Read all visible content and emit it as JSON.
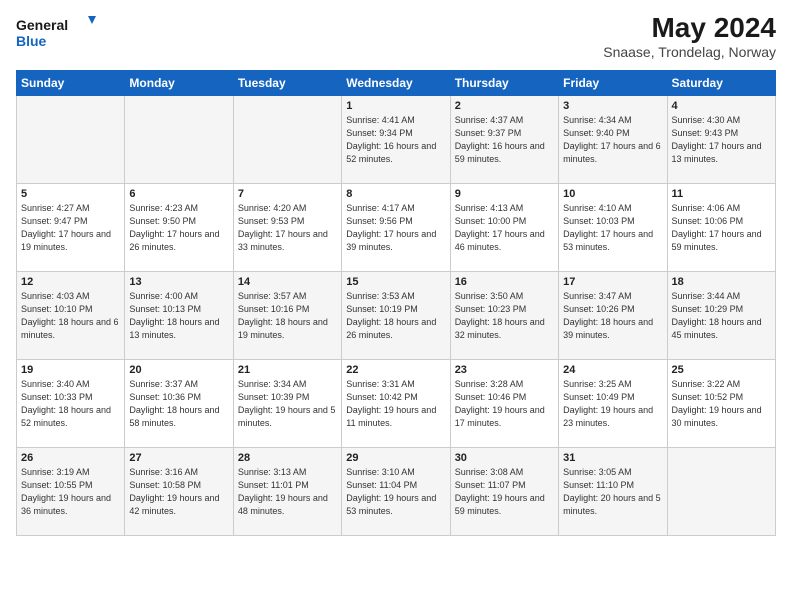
{
  "logo": {
    "line1": "General",
    "line2": "Blue"
  },
  "title": "May 2024",
  "subtitle": "Snaase, Trondelag, Norway",
  "days_header": [
    "Sunday",
    "Monday",
    "Tuesday",
    "Wednesday",
    "Thursday",
    "Friday",
    "Saturday"
  ],
  "weeks": [
    [
      {
        "day": "",
        "info": ""
      },
      {
        "day": "",
        "info": ""
      },
      {
        "day": "",
        "info": ""
      },
      {
        "day": "1",
        "info": "Sunrise: 4:41 AM\nSunset: 9:34 PM\nDaylight: 16 hours and 52 minutes."
      },
      {
        "day": "2",
        "info": "Sunrise: 4:37 AM\nSunset: 9:37 PM\nDaylight: 16 hours and 59 minutes."
      },
      {
        "day": "3",
        "info": "Sunrise: 4:34 AM\nSunset: 9:40 PM\nDaylight: 17 hours and 6 minutes."
      },
      {
        "day": "4",
        "info": "Sunrise: 4:30 AM\nSunset: 9:43 PM\nDaylight: 17 hours and 13 minutes."
      }
    ],
    [
      {
        "day": "5",
        "info": "Sunrise: 4:27 AM\nSunset: 9:47 PM\nDaylight: 17 hours and 19 minutes."
      },
      {
        "day": "6",
        "info": "Sunrise: 4:23 AM\nSunset: 9:50 PM\nDaylight: 17 hours and 26 minutes."
      },
      {
        "day": "7",
        "info": "Sunrise: 4:20 AM\nSunset: 9:53 PM\nDaylight: 17 hours and 33 minutes."
      },
      {
        "day": "8",
        "info": "Sunrise: 4:17 AM\nSunset: 9:56 PM\nDaylight: 17 hours and 39 minutes."
      },
      {
        "day": "9",
        "info": "Sunrise: 4:13 AM\nSunset: 10:00 PM\nDaylight: 17 hours and 46 minutes."
      },
      {
        "day": "10",
        "info": "Sunrise: 4:10 AM\nSunset: 10:03 PM\nDaylight: 17 hours and 53 minutes."
      },
      {
        "day": "11",
        "info": "Sunrise: 4:06 AM\nSunset: 10:06 PM\nDaylight: 17 hours and 59 minutes."
      }
    ],
    [
      {
        "day": "12",
        "info": "Sunrise: 4:03 AM\nSunset: 10:10 PM\nDaylight: 18 hours and 6 minutes."
      },
      {
        "day": "13",
        "info": "Sunrise: 4:00 AM\nSunset: 10:13 PM\nDaylight: 18 hours and 13 minutes."
      },
      {
        "day": "14",
        "info": "Sunrise: 3:57 AM\nSunset: 10:16 PM\nDaylight: 18 hours and 19 minutes."
      },
      {
        "day": "15",
        "info": "Sunrise: 3:53 AM\nSunset: 10:19 PM\nDaylight: 18 hours and 26 minutes."
      },
      {
        "day": "16",
        "info": "Sunrise: 3:50 AM\nSunset: 10:23 PM\nDaylight: 18 hours and 32 minutes."
      },
      {
        "day": "17",
        "info": "Sunrise: 3:47 AM\nSunset: 10:26 PM\nDaylight: 18 hours and 39 minutes."
      },
      {
        "day": "18",
        "info": "Sunrise: 3:44 AM\nSunset: 10:29 PM\nDaylight: 18 hours and 45 minutes."
      }
    ],
    [
      {
        "day": "19",
        "info": "Sunrise: 3:40 AM\nSunset: 10:33 PM\nDaylight: 18 hours and 52 minutes."
      },
      {
        "day": "20",
        "info": "Sunrise: 3:37 AM\nSunset: 10:36 PM\nDaylight: 18 hours and 58 minutes."
      },
      {
        "day": "21",
        "info": "Sunrise: 3:34 AM\nSunset: 10:39 PM\nDaylight: 19 hours and 5 minutes."
      },
      {
        "day": "22",
        "info": "Sunrise: 3:31 AM\nSunset: 10:42 PM\nDaylight: 19 hours and 11 minutes."
      },
      {
        "day": "23",
        "info": "Sunrise: 3:28 AM\nSunset: 10:46 PM\nDaylight: 19 hours and 17 minutes."
      },
      {
        "day": "24",
        "info": "Sunrise: 3:25 AM\nSunset: 10:49 PM\nDaylight: 19 hours and 23 minutes."
      },
      {
        "day": "25",
        "info": "Sunrise: 3:22 AM\nSunset: 10:52 PM\nDaylight: 19 hours and 30 minutes."
      }
    ],
    [
      {
        "day": "26",
        "info": "Sunrise: 3:19 AM\nSunset: 10:55 PM\nDaylight: 19 hours and 36 minutes."
      },
      {
        "day": "27",
        "info": "Sunrise: 3:16 AM\nSunset: 10:58 PM\nDaylight: 19 hours and 42 minutes."
      },
      {
        "day": "28",
        "info": "Sunrise: 3:13 AM\nSunset: 11:01 PM\nDaylight: 19 hours and 48 minutes."
      },
      {
        "day": "29",
        "info": "Sunrise: 3:10 AM\nSunset: 11:04 PM\nDaylight: 19 hours and 53 minutes."
      },
      {
        "day": "30",
        "info": "Sunrise: 3:08 AM\nSunset: 11:07 PM\nDaylight: 19 hours and 59 minutes."
      },
      {
        "day": "31",
        "info": "Sunrise: 3:05 AM\nSunset: 11:10 PM\nDaylight: 20 hours and 5 minutes."
      },
      {
        "day": "",
        "info": ""
      }
    ]
  ]
}
